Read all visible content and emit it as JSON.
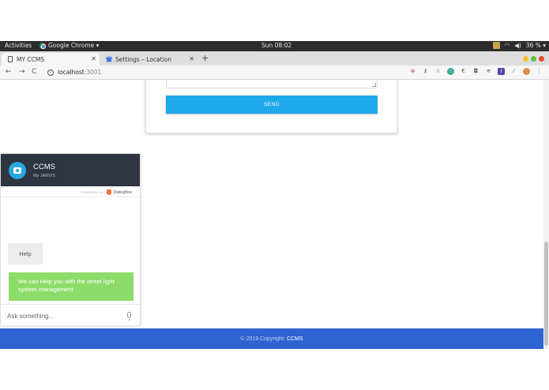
{
  "system_bar": {
    "activities": "Activities",
    "app_name": "Google Chrome ▾",
    "clock": "Sun 08:02",
    "battery": "36 % ▾"
  },
  "tabs": [
    {
      "title": "MY CCMS",
      "active": true
    },
    {
      "title": "Settings – Location",
      "active": false
    }
  ],
  "address_bar": {
    "host": "localhost",
    "port": ":3001"
  },
  "form": {
    "send_label": "SEND"
  },
  "chat": {
    "title": "CCMS",
    "subtitle": "My JARVIS",
    "powered_by": "POWERED BY",
    "powered_brand": "Dialogflow",
    "messages": [
      {
        "from": "user",
        "text": "Help"
      },
      {
        "from": "bot",
        "text": "We can Help you with the street light system management"
      }
    ],
    "input_placeholder": "Ask something..."
  },
  "footer": {
    "copyright": "© 2019 Copyright:",
    "brand": "CCMS"
  },
  "colors": {
    "send_button": "#1eaaea",
    "chat_header": "#2f3441",
    "bot_bubble": "#8ddc6a",
    "footer": "#2f63d1"
  }
}
